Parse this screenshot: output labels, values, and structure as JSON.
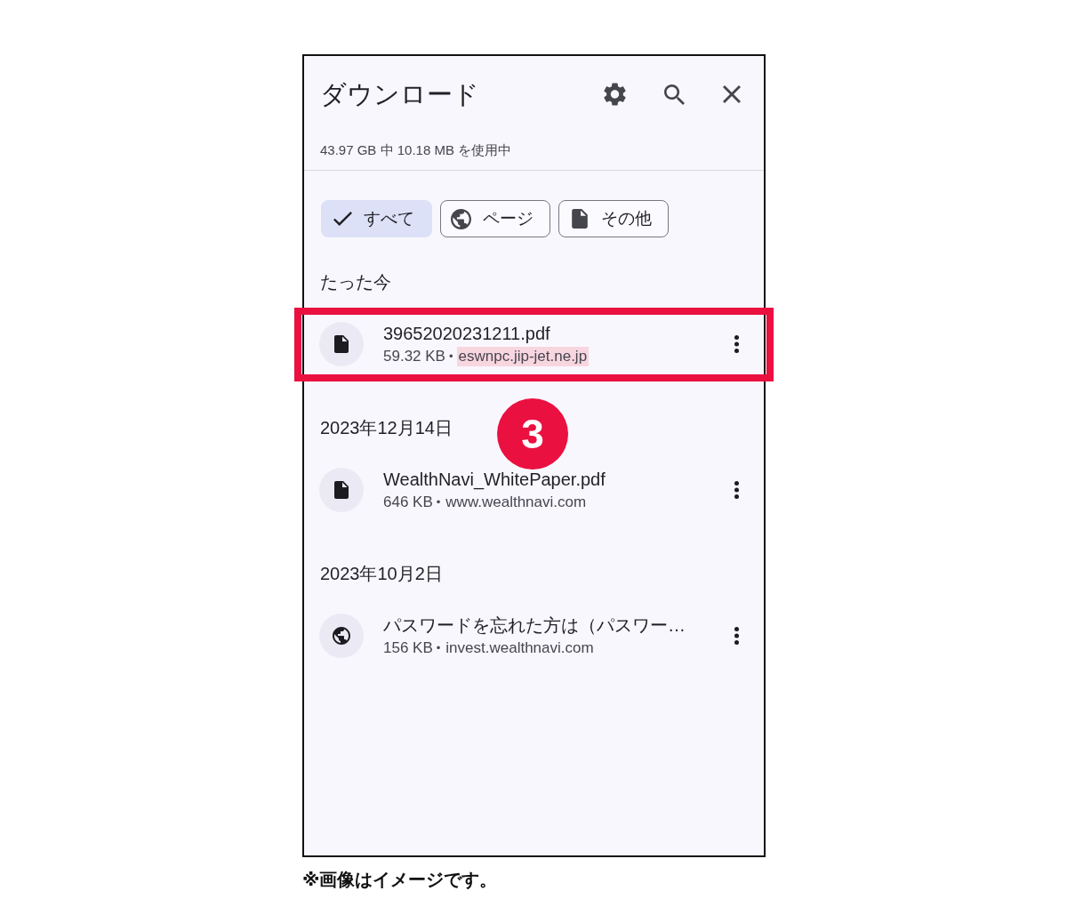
{
  "header": {
    "title": "ダウンロード"
  },
  "storage": "43.97 GB 中 10.18 MB を使用中",
  "filters": [
    {
      "label": "すべて",
      "selected": true
    },
    {
      "label": "ページ",
      "kind": "page",
      "selected": false
    },
    {
      "label": "その他",
      "kind": "other",
      "selected": false
    }
  ],
  "sections": [
    {
      "heading": "たった今",
      "items": [
        {
          "kind": "file",
          "name": "39652020231211.pdf",
          "size": "59.32 KB",
          "separator": "•",
          "source": "eswnpc.jip-jet.ne.jp",
          "source_highlighted": true,
          "highlighted": true
        }
      ]
    },
    {
      "heading": "2023年12月14日",
      "items": [
        {
          "kind": "file",
          "name": "WealthNavi_WhitePaper.pdf",
          "size": "646 KB",
          "separator": "•",
          "source": "www.wealthnavi.com",
          "source_highlighted": false,
          "highlighted": false
        }
      ]
    },
    {
      "heading": "2023年10月2日",
      "items": [
        {
          "kind": "page",
          "name": "パスワードを忘れた方は（パスワー…",
          "size": "156 KB",
          "separator": "•",
          "source": "invest.wealthnavi.com",
          "source_highlighted": false,
          "highlighted": false
        }
      ]
    }
  ],
  "callout": {
    "label": "3"
  },
  "caption": "※画像はイメージです。"
}
